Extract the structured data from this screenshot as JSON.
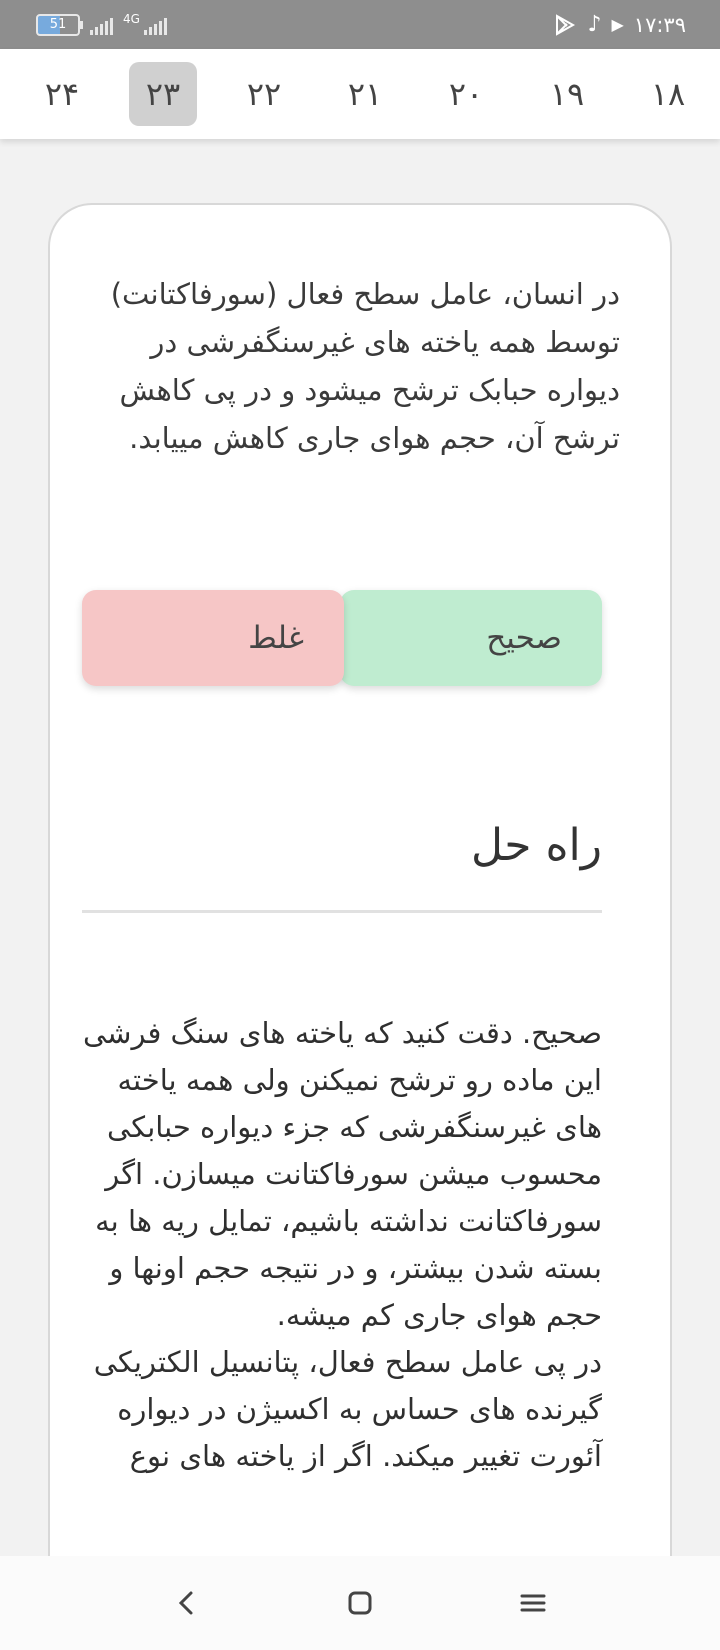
{
  "status_bar": {
    "battery": "51",
    "network": "4G",
    "clock": "۱۷:۳۹"
  },
  "tabs": [
    {
      "label": "۲۴",
      "active": false
    },
    {
      "label": "۲۳",
      "active": true
    },
    {
      "label": "۲۲",
      "active": false
    },
    {
      "label": "۲۱",
      "active": false
    },
    {
      "label": "۲۰",
      "active": false
    },
    {
      "label": "۱۹",
      "active": false
    },
    {
      "label": "۱۸",
      "active": false
    }
  ],
  "question": {
    "text": "در انسان، عامل سطح فعال (سورفاکتانت) توسط همه یاخته های غیرسنگفرشی در دیواره حبابک ترشح میشود و در پی کاهش ترشح آن، حجم هوای جاری کاهش مییابد."
  },
  "answers": {
    "correct_label": "صحیح",
    "wrong_label": "غلط"
  },
  "solution": {
    "title": "راه حل",
    "paragraph1": "صحیح. دقت کنید که یاخته های سنگ فرشی این ماده رو ترشح نمیکنن ولی همه یاخته های غیرسنگفرشی که جزء دیواره حبابکی محسوب میشن سورفاکتانت میسازن. اگر سورفاکتانت نداشته باشیم، تمایل ریه ها به بسته شدن بیشتر، و در نتیجه حجم اونها و حجم هوای جاری کم میشه.",
    "paragraph2": "در پی عامل سطح فعال، پتانسیل الکتریکی گیرنده های حساس به اکسیژن در دیواره آئورت تغییر میکند. اگر از یاخته های نوع"
  },
  "colors": {
    "correct": "#bfecd0",
    "wrong": "#f6c6c6",
    "active_tab": "#d0d0d0",
    "status_bar": "#8e8e8e"
  }
}
